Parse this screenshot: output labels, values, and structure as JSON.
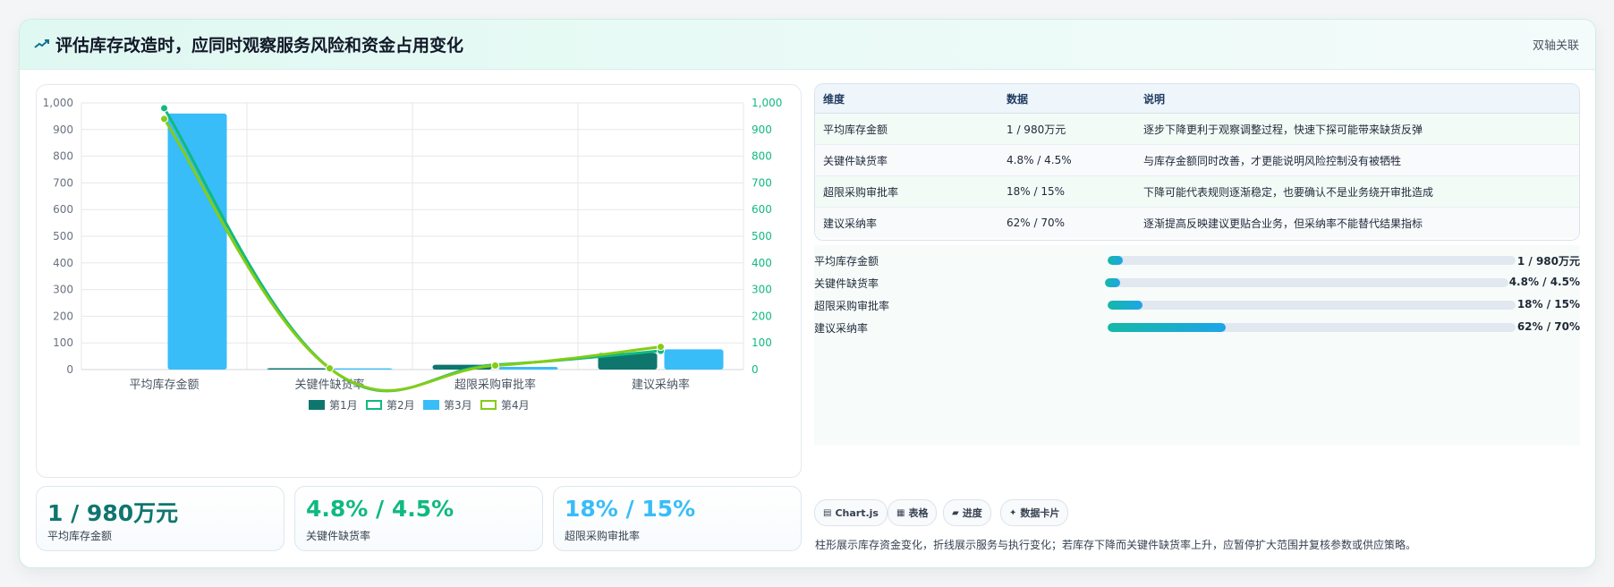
{
  "header": {
    "title": "评估库存改造时，应同时观察服务风险和资金占用变化",
    "badge": "双轴关联"
  },
  "colors": {
    "month1": "#0f766e",
    "month2": "#10b981",
    "month3": "#38bdf8",
    "month4": "#84cc16",
    "accent_green": "#10b981",
    "accent_blue": "#38bdf8"
  },
  "chart_data": {
    "type": "bar",
    "categories": [
      "平均库存金额",
      "关键件缺货率",
      "超限采购审批率",
      "建议采纳率"
    ],
    "series": [
      {
        "name": "第1月",
        "kind": "bar",
        "axis": "left",
        "values": [
          0,
          5,
          18,
          62
        ]
      },
      {
        "name": "第2月",
        "kind": "line",
        "axis": "right",
        "values": [
          980,
          4.8,
          18,
          70
        ]
      },
      {
        "name": "第3月",
        "kind": "bar",
        "axis": "left",
        "values": [
          960,
          4.5,
          10,
          76
        ]
      },
      {
        "name": "第4月",
        "kind": "line",
        "axis": "right",
        "values": [
          940,
          4.5,
          15,
          85
        ]
      }
    ],
    "y_left": {
      "min": 0,
      "max": 1000,
      "ticks": [
        "0",
        "100",
        "200",
        "300",
        "400",
        "500",
        "600",
        "700",
        "800",
        "900",
        "1,000"
      ]
    },
    "y_right": {
      "min": 0,
      "max": 1000,
      "ticks": [
        "0",
        "100",
        "200",
        "300",
        "400",
        "500",
        "600",
        "700",
        "800",
        "900",
        "1,000"
      ]
    },
    "grid": true,
    "legend": "bottom"
  },
  "table": {
    "headers": [
      "维度",
      "数据",
      "说明"
    ],
    "rows": [
      [
        "平均库存金额",
        "1 / 980万元",
        "逐步下降更利于观察调整过程，快速下探可能带来缺货反弹"
      ],
      [
        "关键件缺货率",
        "4.8% / 4.5%",
        "与库存金额同时改善，才更能说明风险控制没有被牺牲"
      ],
      [
        "超限采购审批率",
        "18% / 15%",
        "下降可能代表规则逐渐稳定，也要确认不是业务绕开审批造成"
      ],
      [
        "建议采纳率",
        "62% / 70%",
        "逐渐提高反映建议更贴合业务，但采纳率不能替代结果指标"
      ]
    ]
  },
  "progress": [
    {
      "label": "平均库存金额",
      "value": "1 / 980万元",
      "level": 0.037
    },
    {
      "label": "关键件缺货率",
      "value": "4.8% / 4.5%",
      "level": 0.037
    },
    {
      "label": "超限采购审批率",
      "value": "18% / 15%",
      "level": 0.085
    },
    {
      "label": "建议采纳率",
      "value": "62% / 70%",
      "level": 0.29
    }
  ],
  "kpis": [
    {
      "value": "1 / 980万元",
      "label": "平均库存金额",
      "color": "#0f766e"
    },
    {
      "value": "4.8% / 4.5%",
      "label": "关键件缺货率",
      "color": "#10b981"
    },
    {
      "value": "18% / 15%",
      "label": "超限采购审批率",
      "color": "#38bdf8"
    }
  ],
  "chips": [
    {
      "icon": "chart-icon",
      "label": "Chart.js"
    },
    {
      "icon": "table-icon",
      "label": "表格"
    },
    {
      "icon": "progress-icon",
      "label": "进度"
    },
    {
      "icon": "sparkle-icon",
      "label": "数据卡片"
    }
  ],
  "footnote": "柱形展示库存资金变化，折线展示服务与执行变化；若库存下降而关键件缺货率上升，应暂停扩大范围并复核参数或供应策略。"
}
